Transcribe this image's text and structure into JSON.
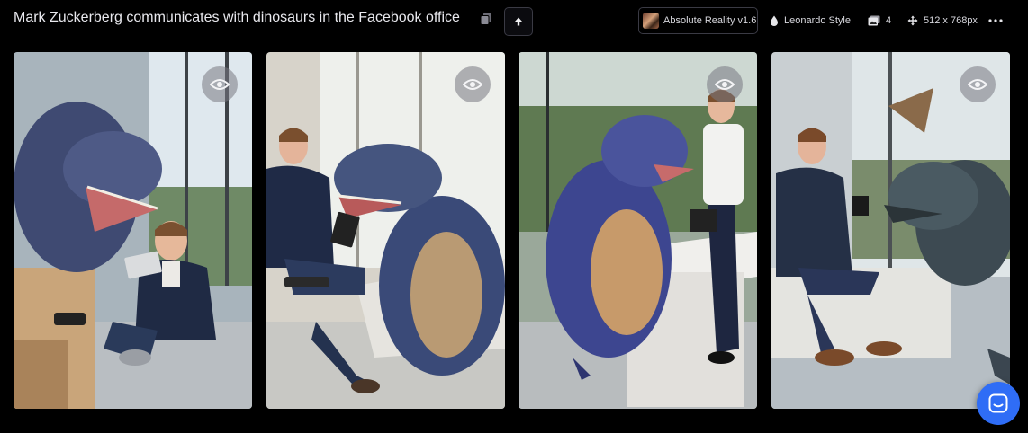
{
  "header": {
    "prompt": "Mark Zuckerberg communicates with dinosaurs in the Facebook office",
    "model": "Absolute Reality v1.6",
    "style": "Leonardo Style",
    "image_count": "4",
    "dimensions": "512 x 768px"
  },
  "icons": {
    "copy": "copy-icon",
    "upload": "arrow-up-icon",
    "style": "drop-icon",
    "images": "image-stack-icon",
    "dimensions": "move-arrows-icon",
    "more": "more-dots-icon",
    "view": "eye-icon",
    "chat": "chat-icon"
  },
  "colors": {
    "background": "#000000",
    "chat_button": "#2f6df6"
  }
}
